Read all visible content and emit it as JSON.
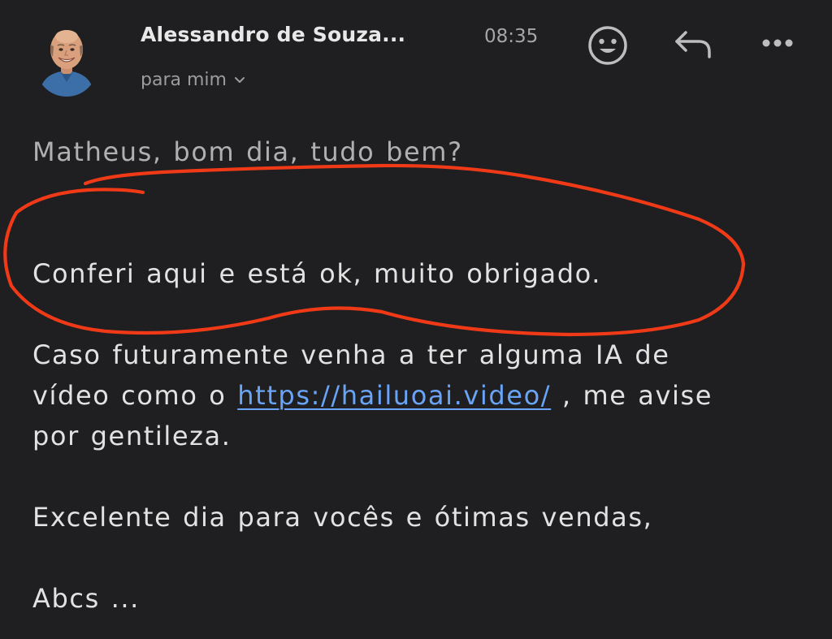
{
  "email": {
    "sender_name": "Alessandro de Souza...",
    "time": "08:35",
    "recipient_label": "para mim",
    "icons": {
      "avatar": "sender-photo",
      "emoji": "emoji-reaction-icon",
      "reply": "reply-icon",
      "more": "more-options-icon",
      "recipient_toggle": "chevron-down-icon"
    },
    "body": {
      "greeting": "Matheus, bom dia, tudo bem?",
      "line1": "Conferi aqui e está ok, muito obrigado.",
      "para2_line1": "Caso futuramente venha a ter alguma IA de",
      "para2_line2_before": "vídeo como o ",
      "link_text": "https://hailuoai.video/",
      "para2_line2_after": " , me avise",
      "para2_line3": "por gentileza.",
      "line4": "Excelente dia para vocês e ótimas vendas,",
      "signoff": "Abcs ..."
    }
  },
  "colors": {
    "background": "#1f1f21",
    "text": "#e2e2e2",
    "muted": "#a6a6a8",
    "link": "#6aa4f6",
    "annotation": "#f03a17"
  }
}
